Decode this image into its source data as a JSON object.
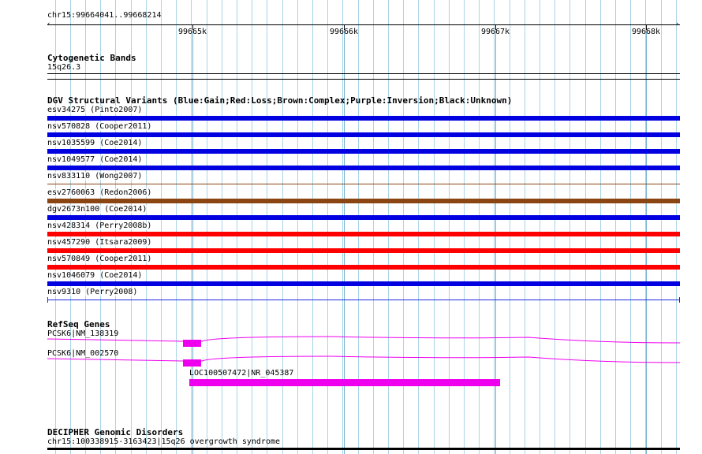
{
  "ruler": {
    "position_label": "chr15:99664041..99668214",
    "ticks": [
      "99665k",
      "99666k",
      "99667k",
      "99668k"
    ]
  },
  "cytoband": {
    "title": "Cytogenetic Bands",
    "band": "15q26.3"
  },
  "dgv": {
    "title": "DGV Structural Variants (Blue:Gain;Red:Loss;Brown:Complex;Purple:Inversion;Black:Unknown)",
    "variants": [
      {
        "label": "esv34275 (Pinto2007)",
        "color": "#0000e0"
      },
      {
        "label": "nsv570828 (Cooper2011)",
        "color": "#0000e0"
      },
      {
        "label": "nsv1035599 (Coe2014)",
        "color": "#0000e0"
      },
      {
        "label": "nsv1049577 (Coe2014)",
        "color": "#0000e0"
      },
      {
        "label": "nsv833110 (Wong2007)",
        "color": "#8b4513"
      },
      {
        "label": "esv2760063 (Redon2006)",
        "color": "#8b4513"
      },
      {
        "label": "dgv2673n100 (Coe2014)",
        "color": "#0000e0"
      },
      {
        "label": "nsv428314 (Perry2008b)",
        "color": "#ff0000"
      },
      {
        "label": "nsv457290 (Itsara2009)",
        "color": "#ff0000"
      },
      {
        "label": "nsv570849 (Cooper2011)",
        "color": "#ff0000"
      },
      {
        "label": "nsv1046079 (Coe2014)",
        "color": "#0000e0"
      },
      {
        "label": "nsv9310 (Perry2008)",
        "color": "#0000e0"
      }
    ]
  },
  "refseq": {
    "title": "RefSeq Genes",
    "genes": [
      {
        "label": "PCSK6|NM_138319",
        "color": "#ee00ee"
      },
      {
        "label": "PCSK6|NM_002570",
        "color": "#ee00ee"
      },
      {
        "label": "LOC100507472|NR_045387",
        "color": "#ee00ee"
      }
    ]
  },
  "decipher": {
    "title": "DECIPHER Genomic Disorders",
    "entry": "chr15:100338915-3163423|15q26 overgrowth syndrome"
  },
  "colors": {
    "grid": "#aad4e6",
    "gain": "#0000e0",
    "loss": "#ff0000",
    "complex": "#8b4513",
    "gene": "#ee00ee"
  }
}
